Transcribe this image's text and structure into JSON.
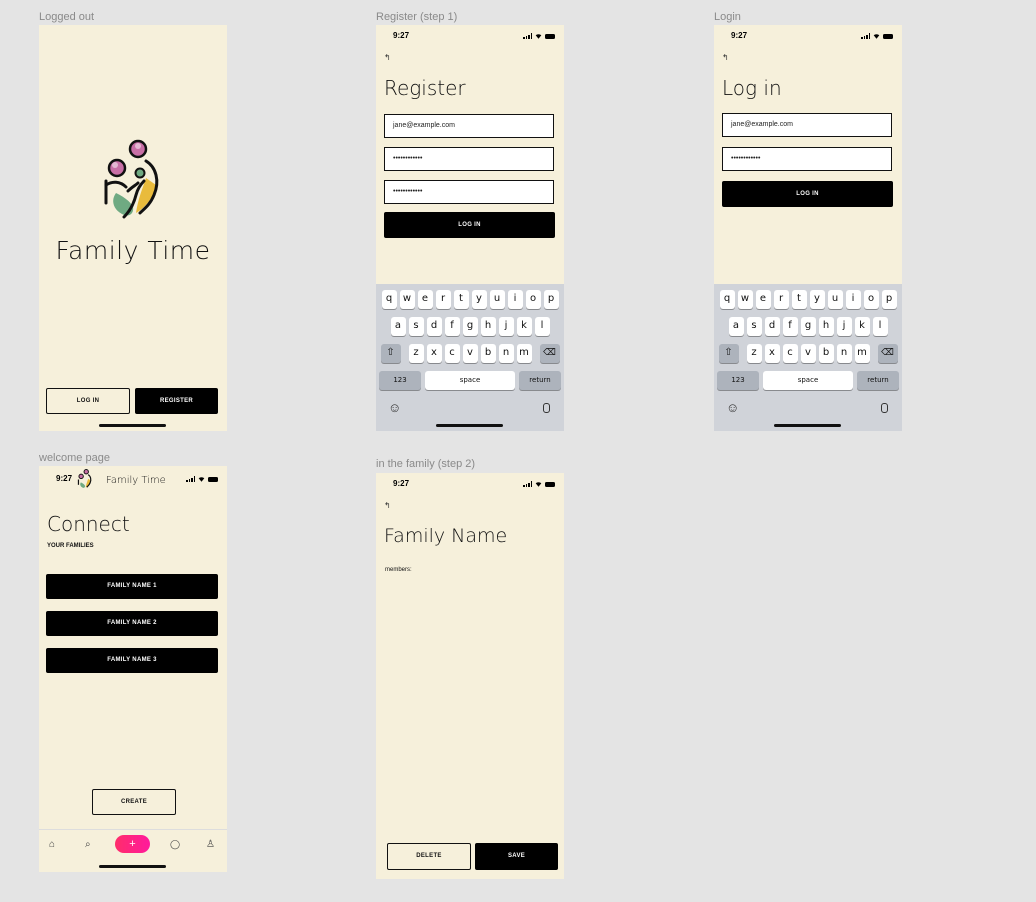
{
  "frames": {
    "logged_out": {
      "label": "Logged out",
      "app_title": "Family Time",
      "login_label": "LOG IN",
      "register_label": "REGISTER"
    },
    "register": {
      "label": "Register (step 1)",
      "time": "9:27",
      "back": "↰",
      "title": "Register",
      "email_value": "jane@example.com",
      "password_value": "••••••••••••",
      "confirm_value": "••••••••••••",
      "submit_label": "LOG IN"
    },
    "login": {
      "label": "Login",
      "time": "9:27",
      "back": "↰",
      "title": "Log in",
      "email_value": "jane@example.com",
      "password_value": "••••••••••••",
      "submit_label": "LOG IN"
    },
    "welcome": {
      "label": "welcome page",
      "time": "9:27",
      "app_name": "Family Time",
      "title": "Connect",
      "subtitle": "YOUR FAMILIES",
      "families": [
        "FAMILY NAME 1",
        "FAMILY NAME 2",
        "FAMILY NAME 3"
      ],
      "create_label": "CREATE",
      "nav": {
        "home": "⌂",
        "search": "⌕",
        "add": "+",
        "chat": "◯",
        "profile": "♙"
      }
    },
    "family": {
      "label": "in the family (step 2)",
      "time": "9:27",
      "back": "↰",
      "title": "Family Name",
      "members_label": "members:",
      "delete_label": "DELETE",
      "save_label": "SAVE"
    }
  },
  "keyboard": {
    "row1": [
      "q",
      "w",
      "e",
      "r",
      "t",
      "y",
      "u",
      "i",
      "o",
      "p"
    ],
    "row2": [
      "a",
      "s",
      "d",
      "f",
      "g",
      "h",
      "j",
      "k",
      "l"
    ],
    "row3": [
      "z",
      "x",
      "c",
      "v",
      "b",
      "n",
      "m"
    ],
    "shift": "⇧",
    "delete": "⌫",
    "numbers": "123",
    "space": "space",
    "return": "return",
    "emoji": "☺",
    "mic": "🎙"
  },
  "colors": {
    "background": "#e4e4e4",
    "frame": "#f6f0db",
    "primary": "#000000",
    "add_button_start": "#ff2d6b",
    "add_button_end": "#ff1a9c"
  }
}
